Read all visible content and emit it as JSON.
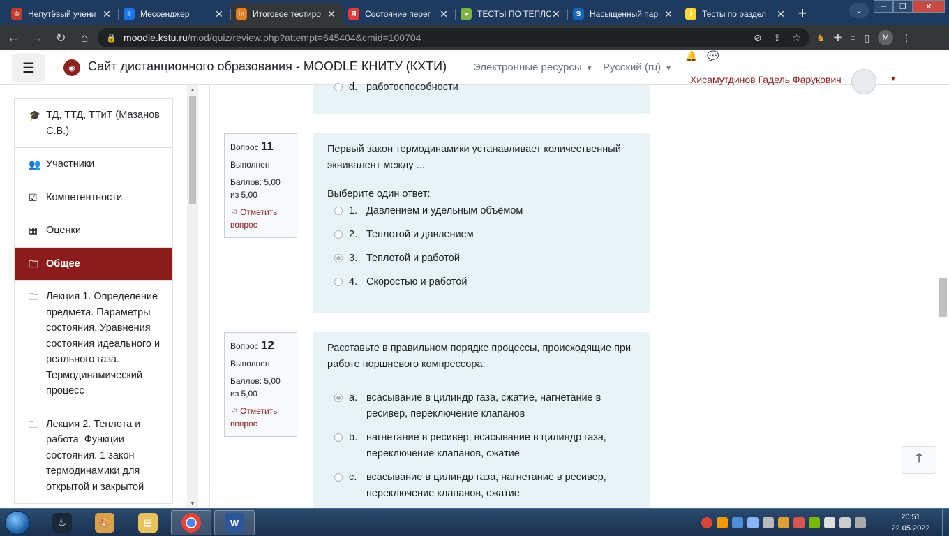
{
  "browser": {
    "tabs": [
      {
        "title": "Непутёвый учени",
        "color": "#c0392b",
        "glyph": "♔"
      },
      {
        "title": "Мессенджер",
        "color": "#1a73e8",
        "glyph": "II"
      },
      {
        "title": "Итоговое тестиро",
        "color": "#e67e22",
        "glyph": "in"
      },
      {
        "title": "Состояние перег",
        "color": "#e53935",
        "glyph": "Я"
      },
      {
        "title": "ТЕСТЫ ПО ТЕПЛО",
        "color": "#7cb342",
        "glyph": "●"
      },
      {
        "title": "Насыщенный пар",
        "color": "#1565c0",
        "glyph": "S"
      },
      {
        "title": "Тесты по раздел",
        "color": "#fdd835",
        "glyph": "i"
      }
    ],
    "active_tab_index": 2,
    "new_tab_label": "+",
    "url_host": "moodle.kstu.ru",
    "url_path": "/mod/quiz/review.php?attempt=645404&cmid=100704",
    "profile_initial": "M"
  },
  "header": {
    "site_name": "Сайт дистанционного образования - MOODLE КНИТУ (КХТИ)",
    "menu_resources": "Электронные ресурсы",
    "menu_language": "Русский ‎(ru)‎",
    "user_name": "Хисамутдинов Гадель Фарукович"
  },
  "sidebar": {
    "items": [
      {
        "label": "ТД, ТТД, ТТиТ (Мазанов С.В.)",
        "icon": "graduation-cap-icon",
        "glyph": "🎓"
      },
      {
        "label": "Участники",
        "icon": "users-icon",
        "glyph": "👥"
      },
      {
        "label": "Компетентности",
        "icon": "checkbox-icon",
        "glyph": "☑"
      },
      {
        "label": "Оценки",
        "icon": "table-icon",
        "glyph": "▦"
      },
      {
        "label": "Общее",
        "icon": "folder-icon",
        "glyph": "🗀",
        "active": true
      },
      {
        "label": "Лекция 1. Определение предмета. Параметры состояния. Уравнения состояния идеального и реального газа. Термодинамический процесс",
        "icon": "folder-icon",
        "glyph": "🗀"
      },
      {
        "label": "Лекция 2. Теплота и работа. Функции состояния. 1 закон термодинамики для открытой и закрытой",
        "icon": "folder-icon",
        "glyph": "🗀"
      }
    ]
  },
  "questions": {
    "prev_tail": {
      "letter": "d.",
      "text": "работоспособности"
    },
    "q11": {
      "label": "Вопрос",
      "number": "11",
      "state": "Выполнен",
      "grade": "Баллов: 5,00 из 5,00",
      "flag": "Отметить вопрос",
      "text": "Первый закон термодинамики устанавливает количественный эквивалент между ...",
      "prompt": "Выберите один ответ:",
      "answers": [
        {
          "num": "1.",
          "text": "Давлением и удельным объёмом",
          "checked": false
        },
        {
          "num": "2.",
          "text": "Теплотой и давлением",
          "checked": false
        },
        {
          "num": "3.",
          "text": "Теплотой и работой",
          "checked": true
        },
        {
          "num": "4.",
          "text": "Скоростью и работой",
          "checked": false
        }
      ]
    },
    "q12": {
      "label": "Вопрос",
      "number": "12",
      "state": "Выполнен",
      "grade": "Баллов: 5,00 из 5,00",
      "flag": "Отметить вопрос",
      "text": "Расставьте в правильном порядке процессы, происходящие при работе поршневого компрессора:",
      "answers": [
        {
          "num": "a.",
          "text": "всасывание в цилиндр газа, сжатие, нагнетание в ресивер, переключение клапанов",
          "checked": true
        },
        {
          "num": "b.",
          "text": "нагнетание в ресивер, всасывание в цилиндр газа, переключение клапанов, сжатие",
          "checked": false
        },
        {
          "num": "c.",
          "text": "всасывание в цилиндр газа, нагнетание в ресивер, переключение клапанов, сжатие",
          "checked": false
        }
      ]
    }
  },
  "taskbar": {
    "time": "20:51",
    "date": "22.05.2022"
  },
  "colors": {
    "brand": "#8c1b1b",
    "question_bg": "#e7f3f5",
    "tab_bar": "#1e3a5f"
  }
}
